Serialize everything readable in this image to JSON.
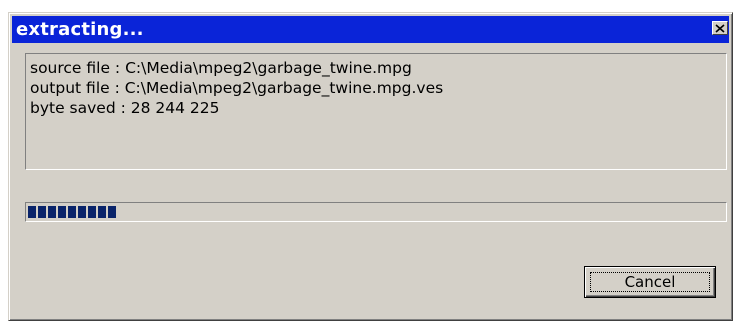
{
  "window": {
    "title": "extracting..."
  },
  "info": {
    "source_line": "source file : C:\\Media\\mpeg2\\garbage_twine.mpg",
    "output_line": "output file : C:\\Media\\mpeg2\\garbage_twine.mpg.ves",
    "bytes_line": "byte saved : 28 244 225"
  },
  "progress": {
    "filled_blocks": 9,
    "color": "#0a246a"
  },
  "buttons": {
    "cancel_label": "Cancel"
  },
  "colors": {
    "titlebar": "#0a24d8",
    "dialog_bg": "#d4d0c8"
  },
  "icons": {
    "close": "close-icon"
  }
}
